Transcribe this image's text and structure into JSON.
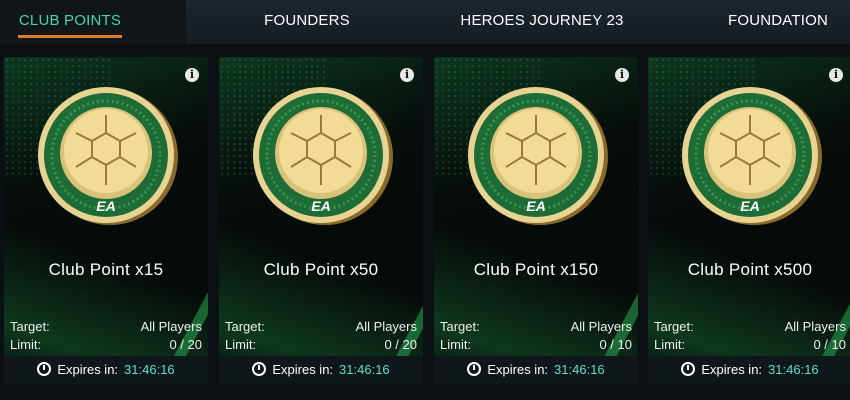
{
  "tabs": [
    {
      "label": "CLUB POINTS",
      "active": true
    },
    {
      "label": "FOUNDERS",
      "active": false
    },
    {
      "label": "HEROES JOURNEY 23",
      "active": false
    },
    {
      "label": "FOUNDATION",
      "active": false
    }
  ],
  "colors": {
    "accent": "#44d4b8",
    "tab_underline": "#e07a2c",
    "timer": "#5ee0c0"
  },
  "cards": [
    {
      "title": "Club Point x15",
      "target_label": "Target:",
      "target_value": "All Players",
      "limit_label": "Limit:",
      "limit_value": "0 / 20",
      "expires_label": "Expires in:",
      "expires_value": "31:46:16",
      "coin_logo": "EA"
    },
    {
      "title": "Club Point x50",
      "target_label": "Target:",
      "target_value": "All Players",
      "limit_label": "Limit:",
      "limit_value": "0 / 20",
      "expires_label": "Expires in:",
      "expires_value": "31:46:16",
      "coin_logo": "EA"
    },
    {
      "title": "Club Point x150",
      "target_label": "Target:",
      "target_value": "All Players",
      "limit_label": "Limit:",
      "limit_value": "0 / 10",
      "expires_label": "Expires in:",
      "expires_value": "31:46:16",
      "coin_logo": "EA"
    },
    {
      "title": "Club Point x500",
      "target_label": "Target:",
      "target_value": "All Players",
      "limit_label": "Limit:",
      "limit_value": "0 / 10",
      "expires_label": "Expires in:",
      "expires_value": "31:46:16",
      "coin_logo": "EA"
    }
  ]
}
